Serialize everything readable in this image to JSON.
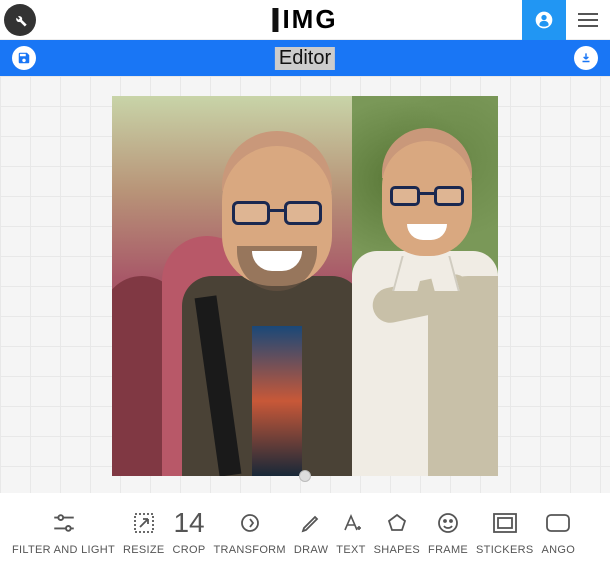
{
  "header": {
    "logo_text": "IMG",
    "wrench_icon": "wrench",
    "user_icon": "user",
    "menu_icon": "menu"
  },
  "editor": {
    "title": "Editor",
    "save_icon": "floppy",
    "download_icon": "download"
  },
  "canvas": {
    "image_description": "Two side-by-side photos of a smiling man with glasses; left in a crowd wearing a jacket, right outdoors in a white shirt with a sweater over shoulders."
  },
  "toolbar": {
    "items": [
      {
        "id": "filter-light",
        "label": "FILTER AND LIGHT",
        "icon": "sliders"
      },
      {
        "id": "resize",
        "label": "RESIZE",
        "icon": "resize"
      },
      {
        "id": "crop",
        "label": "CROP",
        "icon": "crop-14",
        "value": "14"
      },
      {
        "id": "transform",
        "label": "TRANSFORM",
        "icon": "refresh"
      },
      {
        "id": "draw",
        "label": "DRAW",
        "icon": "pencil"
      },
      {
        "id": "text",
        "label": "TEXT",
        "icon": "text-a"
      },
      {
        "id": "shapes",
        "label": "SHAPES",
        "icon": "pentagon"
      },
      {
        "id": "frame",
        "label": "FRAME",
        "icon": "smiley"
      },
      {
        "id": "stickers",
        "label": "STICKERS",
        "icon": "frame-rect"
      },
      {
        "id": "angoli",
        "label": "ANGO",
        "icon": "rounded-rect"
      }
    ]
  }
}
